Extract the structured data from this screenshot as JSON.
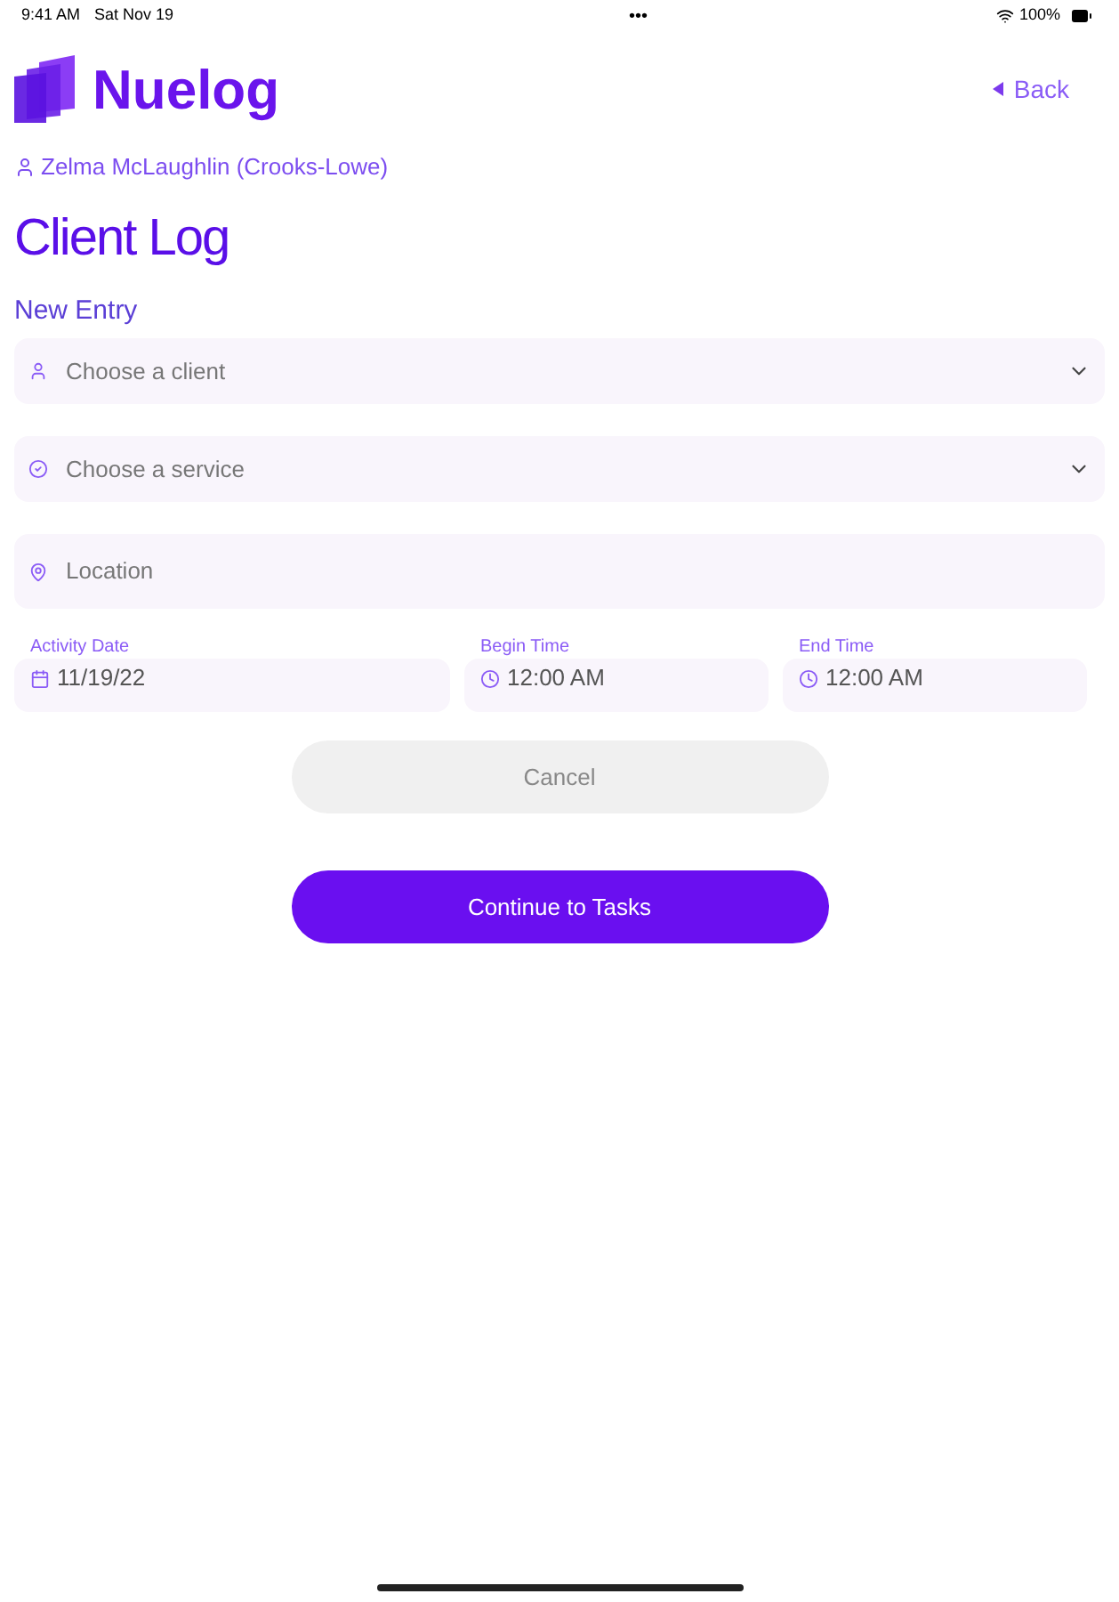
{
  "status_bar": {
    "time": "9:41 AM",
    "date": "Sat Nov 19",
    "dots": "•••",
    "battery": "100%"
  },
  "header": {
    "logo_text": "Nuelog",
    "back": "Back"
  },
  "user": "Zelma McLaughlin (Crooks-Lowe)",
  "title": "Client Log",
  "section": "New Entry",
  "fields": [
    {
      "kind": "select",
      "placeholder": "Choose a client"
    },
    {
      "kind": "select",
      "placeholder": "Choose a service"
    },
    {
      "kind": "input",
      "placeholder": "Location"
    }
  ],
  "datetime": [
    {
      "kind": "date",
      "label": "Activity Date",
      "value": "11/19/22"
    },
    {
      "kind": "time",
      "label": "Begin Time",
      "value": "12:00 AM"
    },
    {
      "kind": "time",
      "label": "End Time",
      "value": "12:00 AM"
    }
  ],
  "buttons": [
    {
      "kind": "secondary",
      "label": "Cancel"
    },
    {
      "kind": "primary",
      "label": "Continue to Tasks"
    }
  ]
}
